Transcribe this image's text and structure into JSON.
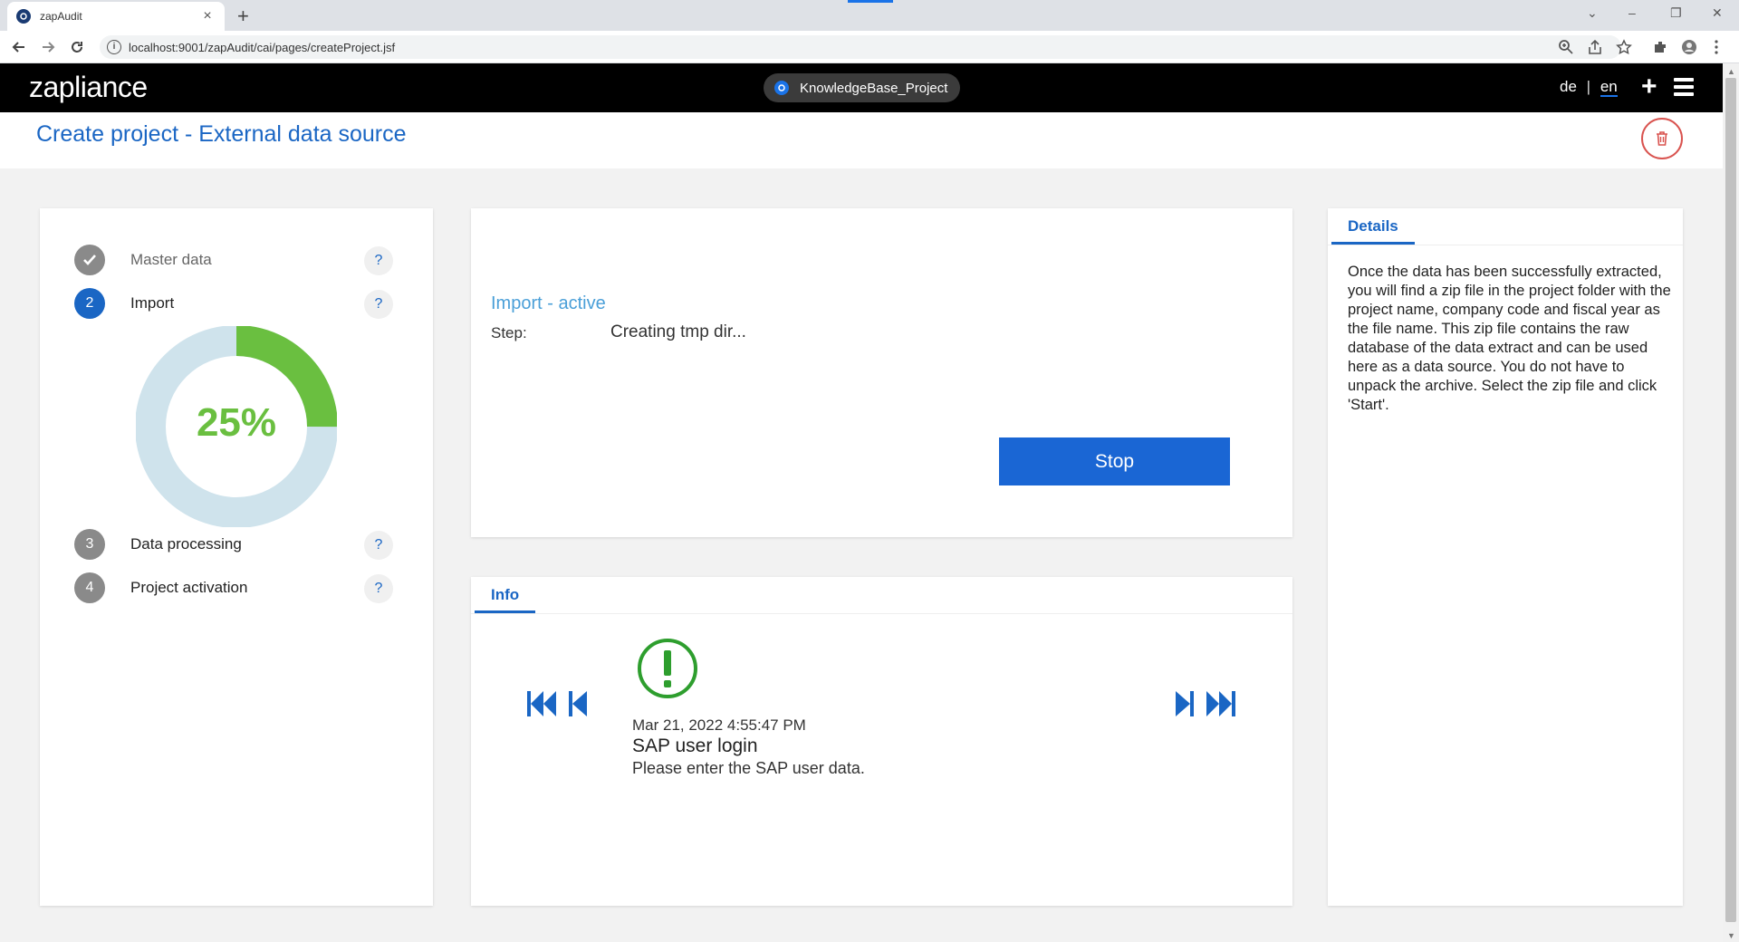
{
  "browser": {
    "tab_title": "zapAudit",
    "url": "localhost:9001/zapAudit/cai/pages/createProject.jsf"
  },
  "header": {
    "logo": "zapliance",
    "project": "KnowledgeBase_Project",
    "lang_de": "de",
    "lang_sep": "|",
    "lang_en": "en"
  },
  "page": {
    "title": "Create project - External data source"
  },
  "steps": [
    {
      "number": "",
      "label": "Master data",
      "state": "done"
    },
    {
      "number": "2",
      "label": "Import",
      "state": "active"
    },
    {
      "number": "3",
      "label": "Data processing",
      "state": "todo"
    },
    {
      "number": "4",
      "label": "Project activation",
      "state": "todo"
    }
  ],
  "help_label": "?",
  "progress": {
    "value": 25,
    "label": "25%",
    "fill_color": "#6abf40",
    "track_color": "#cfe3ec"
  },
  "status": {
    "title": "Import - active",
    "step_key": "Step:",
    "step_value": "Creating tmp dir...",
    "stop_label": "Stop"
  },
  "info": {
    "tab_label": "Info",
    "date": "Mar 21, 2022 4:55:47 PM",
    "title": "SAP user login",
    "body": "Please enter the SAP user data."
  },
  "details": {
    "tab_label": "Details",
    "text": "Once the data has been successfully extracted, you will find a zip file in the project folder with the project name, company code and fiscal year as the file name. This zip file contains the raw database of the data extract and can be used here as a data source. You do not have to unpack the archive. Select the zip file and click 'Start'."
  },
  "colors": {
    "accent": "#1a66c4",
    "success": "#2e9e2e",
    "danger": "#d9534f"
  }
}
